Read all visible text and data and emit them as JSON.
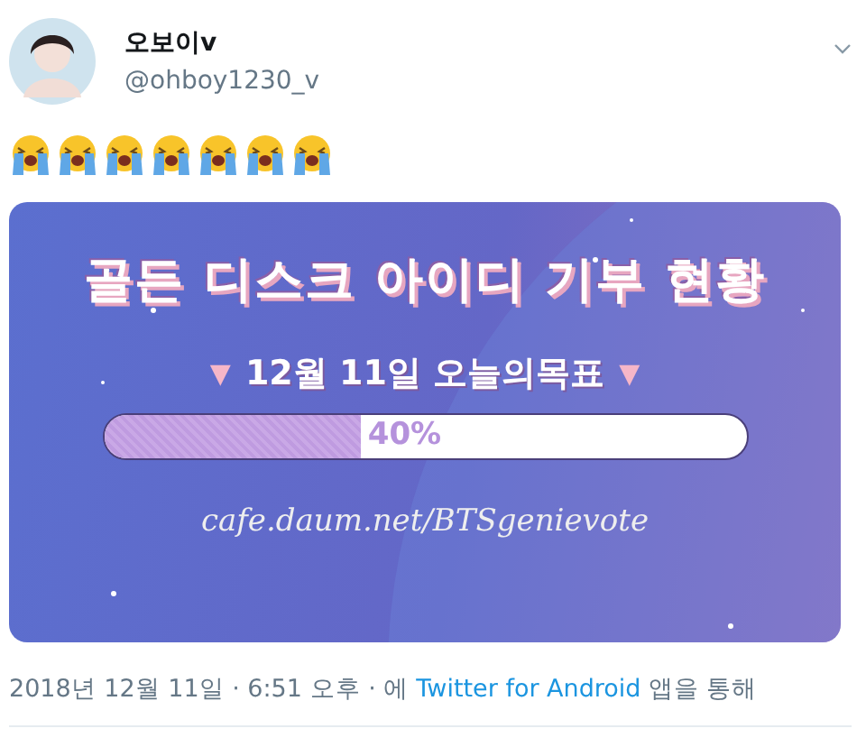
{
  "author": {
    "name": "오보이v",
    "handle": "@ohboy1230_v"
  },
  "emoji": [
    {
      "kind": "crying"
    },
    {
      "kind": "crying"
    },
    {
      "kind": "crying"
    },
    {
      "kind": "crying"
    },
    {
      "kind": "crying"
    },
    {
      "kind": "crying"
    },
    {
      "kind": "crying"
    }
  ],
  "graphic": {
    "title": "골든 디스크 아이디 기부 현황",
    "marker_left": "▼",
    "subtitle": "12월 11일 오늘의목표",
    "marker_right": "▼",
    "progress": {
      "level": 0.4,
      "reading": "40%"
    },
    "url": "cafe.daum.net/BTSgenievote"
  },
  "footer": {
    "date": "2018년 12월 11일 · 6:51 오후 · 에",
    "source": "Twitter for Android",
    "suffix": "앱을 통해"
  }
}
